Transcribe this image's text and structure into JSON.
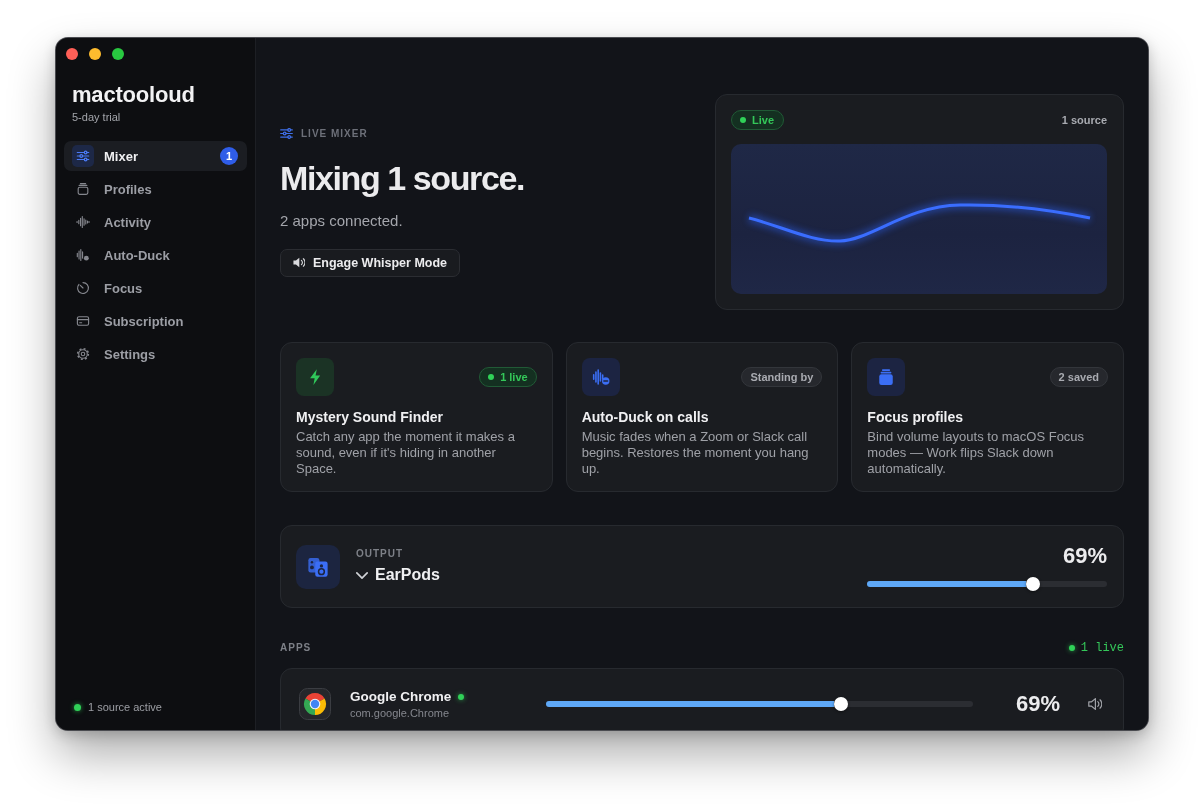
{
  "sidebar": {
    "logo": "mactooloud",
    "plan": "5-day trial",
    "items": [
      {
        "label": "Mixer",
        "selected": true,
        "badge": "1"
      },
      {
        "label": "Profiles",
        "selected": false
      },
      {
        "label": "Activity",
        "selected": false
      },
      {
        "label": "Auto-Duck",
        "selected": false
      },
      {
        "label": "Focus",
        "selected": false
      },
      {
        "label": "Subscription",
        "selected": false
      },
      {
        "label": "Settings",
        "selected": false
      }
    ],
    "footer_status": "1 source active"
  },
  "hero": {
    "eyebrow": "LIVE MIXER",
    "title": "Mixing 1 source.",
    "subtitle": "2 apps connected.",
    "button": "Engage Whisper Mode"
  },
  "live_panel": {
    "status": "Live",
    "sources": "1 source"
  },
  "features": [
    {
      "title": "Mystery Sound Finder",
      "description": "Catch any app the moment it makes a sound, even if it's hiding in another Space.",
      "badge": {
        "kind": "live",
        "text": "1 live"
      }
    },
    {
      "title": "Auto-Duck on calls",
      "description": "Music fades when a Zoom or Slack call begins. Restores the moment you hang up.",
      "badge": {
        "kind": "neutral",
        "text": "Standing by"
      }
    },
    {
      "title": "Focus profiles",
      "description": "Bind volume layouts to macOS Focus modes — Work flips Slack down automatically.",
      "badge": {
        "kind": "neutral",
        "text": "2 saved"
      }
    }
  ],
  "output": {
    "label": "OUTPUT",
    "device": "EarPods",
    "volume": "69%",
    "level": 0.69
  },
  "apps": {
    "heading": "APPS",
    "live_count": "1 live",
    "items": [
      {
        "name": "Google Chrome",
        "bundle_id": "com.google.Chrome",
        "live": true,
        "volume": "69%",
        "level": 0.69
      }
    ]
  }
}
